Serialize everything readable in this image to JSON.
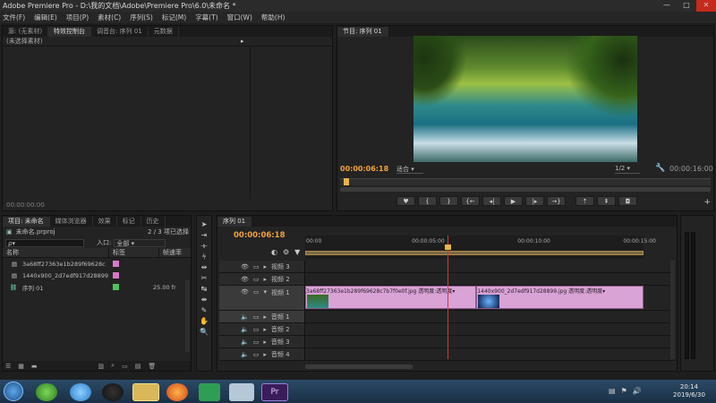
{
  "window": {
    "title": "Adobe Premiere Pro - D:\\我的文档\\Adobe\\Premiere Pro\\6.0\\未命名 *",
    "min": "—",
    "max": "□",
    "close": "✕"
  },
  "menu": [
    "文件(F)",
    "编辑(E)",
    "项目(P)",
    "素材(C)",
    "序列(S)",
    "标记(M)",
    "字幕(T)",
    "窗口(W)",
    "帮助(H)"
  ],
  "source_panel": {
    "tabs": [
      "源: (无素材)",
      "特效控制台",
      "调音台: 序列 01",
      "元数据"
    ],
    "none_selected": "(未选择素材)",
    "timecode": "00:00:00:00"
  },
  "program_monitor": {
    "tab": "节目: 序列 01",
    "timecode_current": "00:00:06:18",
    "fit": "适合",
    "resolution": "1/2",
    "timecode_total": "00:00:16:00",
    "playhead_fraction": 0.01
  },
  "project_panel": {
    "tabs": [
      "项目: 未命名",
      "媒体浏览器",
      "效果",
      "标记",
      "历史"
    ],
    "project_file": "未命名.prproj",
    "selection_count": "2 / 3 项已选择",
    "search_placeholder": "ρ▾",
    "entry_label": "入口:",
    "entry_value": "全部",
    "columns": {
      "name": "名称",
      "label": "标签",
      "frame_rate": "帧速率"
    },
    "items": [
      {
        "name": "3a68ff27363e1b289f69628c",
        "label_color": "#d977c9",
        "rate": ""
      },
      {
        "name": "1440x900_2d7edf917d28899",
        "label_color": "#d977c9",
        "rate": ""
      },
      {
        "name": "序列 01",
        "label_color": "#4fc25b",
        "rate": "25.00 fr"
      }
    ]
  },
  "timeline": {
    "tab": "序列 01",
    "timecode": "00:00:06:18",
    "ruler": [
      "00:00",
      "00:00:05:00",
      "00:00:10:00",
      "00:00:15:00"
    ],
    "playhead_seconds": 6.72,
    "duration_seconds": 16,
    "video_tracks": [
      "视频 3",
      "视频 2",
      "视频 1"
    ],
    "audio_tracks": [
      "音频 1",
      "音频 2",
      "音频 3",
      "音频 4"
    ],
    "clips": [
      {
        "name": "3a68ff27363e1b289f69628c7b7f0e0f.jpg",
        "effect": "透明度:透明度▾",
        "start": 0,
        "end": 8.1
      },
      {
        "name": "1440x900_2d7edf917d28899.jpg",
        "effect": "透明度:透明度▾",
        "start": 8.1,
        "end": 16
      }
    ]
  },
  "tools": [
    "select-tool",
    "track-select-tool",
    "ripple-edit-tool",
    "rolling-edit-tool",
    "rate-stretch-tool",
    "razor-tool",
    "slip-tool",
    "slide-tool",
    "pen-tool",
    "hand-tool",
    "zoom-tool"
  ],
  "taskbar": {
    "time": "20:14",
    "date": "2019/6/30"
  },
  "colors": {
    "accent_timecode": "#f2a33a",
    "clip": "#d9a3d6",
    "playhead": "#d23a3a"
  }
}
